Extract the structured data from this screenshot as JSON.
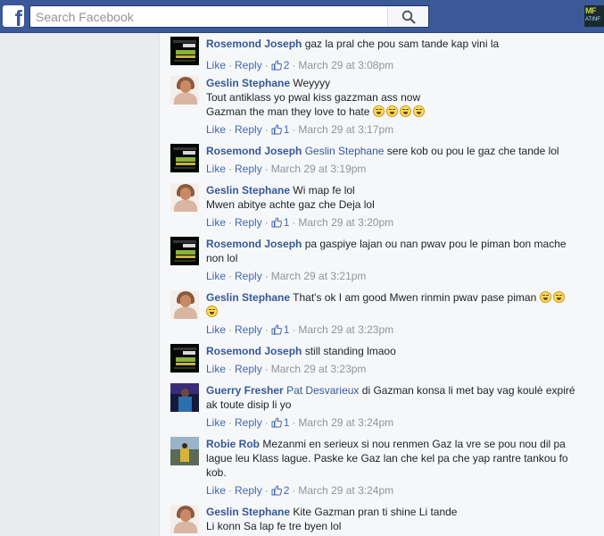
{
  "header": {
    "search_placeholder": "Search Facebook",
    "logo_letter": "f",
    "avatar_text": "MF",
    "avatar_sub": "ATINF"
  },
  "comments": [
    {
      "author": "Rosemond Joseph",
      "avatar": "rosemond-avatar",
      "mention": "",
      "text_lines": [
        "gaz la pral che pou sam tande kap vini la"
      ],
      "emoji_count": 0,
      "like_label": "Like",
      "reply_label": "Reply",
      "likes": "2",
      "time": "March 29 at 3:08pm"
    },
    {
      "author": "Geslin Stephane",
      "avatar": "geslin-avatar",
      "mention": "",
      "text_lines": [
        "Weyyyy",
        "Tout antiklass yo pwal kiss gazzman ass now",
        "Gazman the man they love to hate"
      ],
      "emoji_count": 4,
      "like_label": "Like",
      "reply_label": "Reply",
      "likes": "1",
      "time": "March 29 at 3:17pm"
    },
    {
      "author": "Rosemond Joseph",
      "avatar": "rosemond-avatar",
      "mention": "Geslin Stephane",
      "text_lines": [
        "sere kob ou pou le gaz che tande lol"
      ],
      "emoji_count": 0,
      "like_label": "Like",
      "reply_label": "Reply",
      "likes": "",
      "time": "March 29 at 3:19pm"
    },
    {
      "author": "Geslin Stephane",
      "avatar": "geslin-avatar",
      "mention": "",
      "text_lines": [
        "Wi map fe lol",
        "Mwen abitye achte gaz che Deja lol"
      ],
      "emoji_count": 0,
      "like_label": "Like",
      "reply_label": "Reply",
      "likes": "1",
      "time": "March 29 at 3:20pm"
    },
    {
      "author": "Rosemond Joseph",
      "avatar": "rosemond-avatar",
      "mention": "",
      "text_lines": [
        "pa gaspiye lajan ou nan pwav pou le piman bon mache",
        "non lol"
      ],
      "emoji_count": 0,
      "like_label": "Like",
      "reply_label": "Reply",
      "likes": "",
      "time": "March 29 at 3:21pm"
    },
    {
      "author": "Geslin Stephane",
      "avatar": "geslin-avatar",
      "mention": "",
      "text_lines": [
        "That's ok I am good Mwen rinmin pwav pase piman"
      ],
      "emoji_count": 3,
      "like_label": "Like",
      "reply_label": "Reply",
      "likes": "1",
      "time": "March 29 at 3:23pm"
    },
    {
      "author": "Rosemond Joseph",
      "avatar": "rosemond-avatar",
      "mention": "",
      "text_lines": [
        "still standing lmaoo"
      ],
      "emoji_count": 0,
      "like_label": "Like",
      "reply_label": "Reply",
      "likes": "",
      "time": "March 29 at 3:23pm"
    },
    {
      "author": "Guerry Fresher",
      "avatar": "guerry-avatar",
      "mention": "Pat Desvarieux",
      "text_lines": [
        "di Gazman konsa li met bay vag koulè expiré",
        "ak toute disip li yo"
      ],
      "emoji_count": 0,
      "like_label": "Like",
      "reply_label": "Reply",
      "likes": "1",
      "time": "March 29 at 3:24pm"
    },
    {
      "author": "Robie Rob",
      "avatar": "robie-avatar",
      "mention": "",
      "text_lines": [
        "Mezanmi en serieux si nou renmen Gaz la vre se pou nou dil pa",
        "lague leu Klass lague. Paske ke Gaz lan che kel pa che yap rantre tankou fo",
        "kob."
      ],
      "emoji_count": 0,
      "like_label": "Like",
      "reply_label": "Reply",
      "likes": "2",
      "time": "March 29 at 3:24pm"
    },
    {
      "author": "Geslin Stephane",
      "avatar": "geslin-avatar",
      "mention": "",
      "text_lines": [
        "Kite Gazman pran ti shine Li tande",
        "Li konn Sa lap fe tre byen lol"
      ],
      "emoji_count": 0,
      "like_label": "",
      "reply_label": "",
      "likes": "",
      "time": ""
    }
  ]
}
